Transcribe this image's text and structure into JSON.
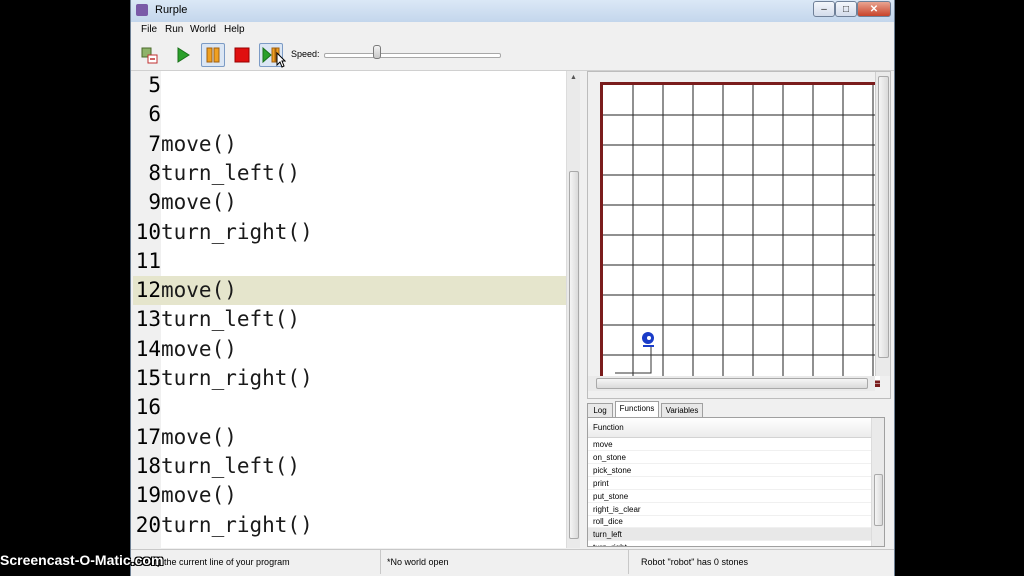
{
  "window": {
    "title": "Rurple"
  },
  "menu": {
    "items": [
      "File",
      "Run",
      "World",
      "Help"
    ]
  },
  "toolbar": {
    "speed_label": "Speed:",
    "speed_level": 0.3
  },
  "editor": {
    "lines": [
      {
        "num": "5",
        "code": ""
      },
      {
        "num": "6",
        "code": ""
      },
      {
        "num": "7",
        "code": "move()"
      },
      {
        "num": "8",
        "code": "turn_left()"
      },
      {
        "num": "9",
        "code": "move()"
      },
      {
        "num": "10",
        "code": "turn_right()"
      },
      {
        "num": "11",
        "code": ""
      },
      {
        "num": "12",
        "code": "move()"
      },
      {
        "num": "13",
        "code": "turn_left()"
      },
      {
        "num": "14",
        "code": "move()"
      },
      {
        "num": "15",
        "code": "turn_right()"
      },
      {
        "num": "16",
        "code": ""
      },
      {
        "num": "17",
        "code": "move()"
      },
      {
        "num": "18",
        "code": "turn_left()"
      },
      {
        "num": "19",
        "code": "move()"
      },
      {
        "num": "20",
        "code": "turn_right()"
      }
    ],
    "highlighted_line": "12"
  },
  "world": {
    "robot_column": 1,
    "robot_row": 2
  },
  "tabs": [
    {
      "label": "Log",
      "active": false
    },
    {
      "label": "Functions",
      "active": true
    },
    {
      "label": "Variables",
      "active": false
    }
  ],
  "functions": {
    "header": "Function",
    "items": [
      "move",
      "on_stone",
      "pick_stone",
      "print",
      "put_stone",
      "right_is_clear",
      "roll_dice",
      "turn_left",
      "turn_right"
    ],
    "selected": "turn_left"
  },
  "status": {
    "left": "only the current line of your program",
    "middle": "*No world open",
    "right": "Robot \"robot\" has 0 stones"
  },
  "watermark": "Screencast-O-Matic.com",
  "colors": {
    "highlight": "#e5e5cc",
    "world_border": "#7a1c1c",
    "robot": "#1a3cc8"
  }
}
